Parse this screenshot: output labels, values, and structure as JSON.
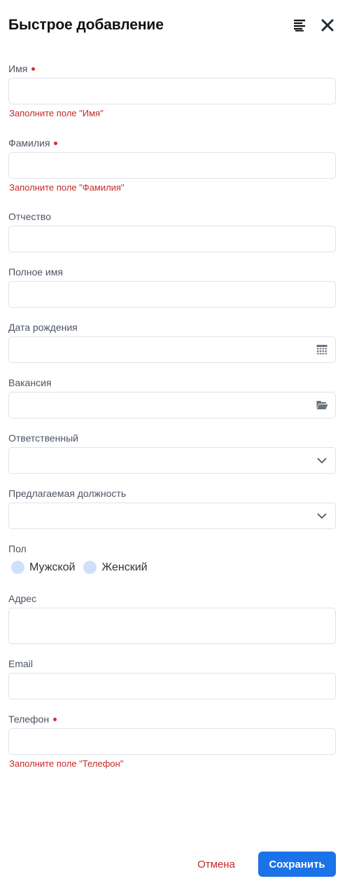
{
  "header": {
    "title": "Быстрое добавление",
    "icons": [
      "document-lines-icon",
      "close-icon"
    ]
  },
  "fields": {
    "first_name": {
      "label": "Имя",
      "value": "",
      "required": true,
      "error": "Заполните поле \"Имя\""
    },
    "last_name": {
      "label": "Фамилия",
      "value": "",
      "required": true,
      "error": "Заполните поле \"Фамилия\""
    },
    "patronymic": {
      "label": "Отчество",
      "value": ""
    },
    "full_name": {
      "label": "Полное имя",
      "value": ""
    },
    "birth_date": {
      "label": "Дата рождения",
      "value": "",
      "icon": "calendar-icon"
    },
    "vacancy": {
      "label": "Вакансия",
      "value": "",
      "icon": "folder-icon"
    },
    "responsible": {
      "label": "Ответственный",
      "value": "",
      "icon": "chevron-down-icon"
    },
    "position": {
      "label": "Предлагаемая должность",
      "value": "",
      "icon": "chevron-down-icon"
    },
    "gender": {
      "label": "Пол",
      "options": [
        "Мужской",
        "Женский"
      ],
      "selected": null
    },
    "address": {
      "label": "Адрес",
      "value": ""
    },
    "email": {
      "label": "Email",
      "value": ""
    },
    "phone": {
      "label": "Телефон",
      "value": "",
      "required": true,
      "error": "Заполните поле \"Телефон\""
    }
  },
  "footer": {
    "cancel_label": "Отмена",
    "save_label": "Сохранить"
  },
  "colors": {
    "primary": "#1a73e8",
    "error": "#c62828",
    "radio_unselected": "#cfe0fb",
    "border": "#dfe3e8"
  }
}
